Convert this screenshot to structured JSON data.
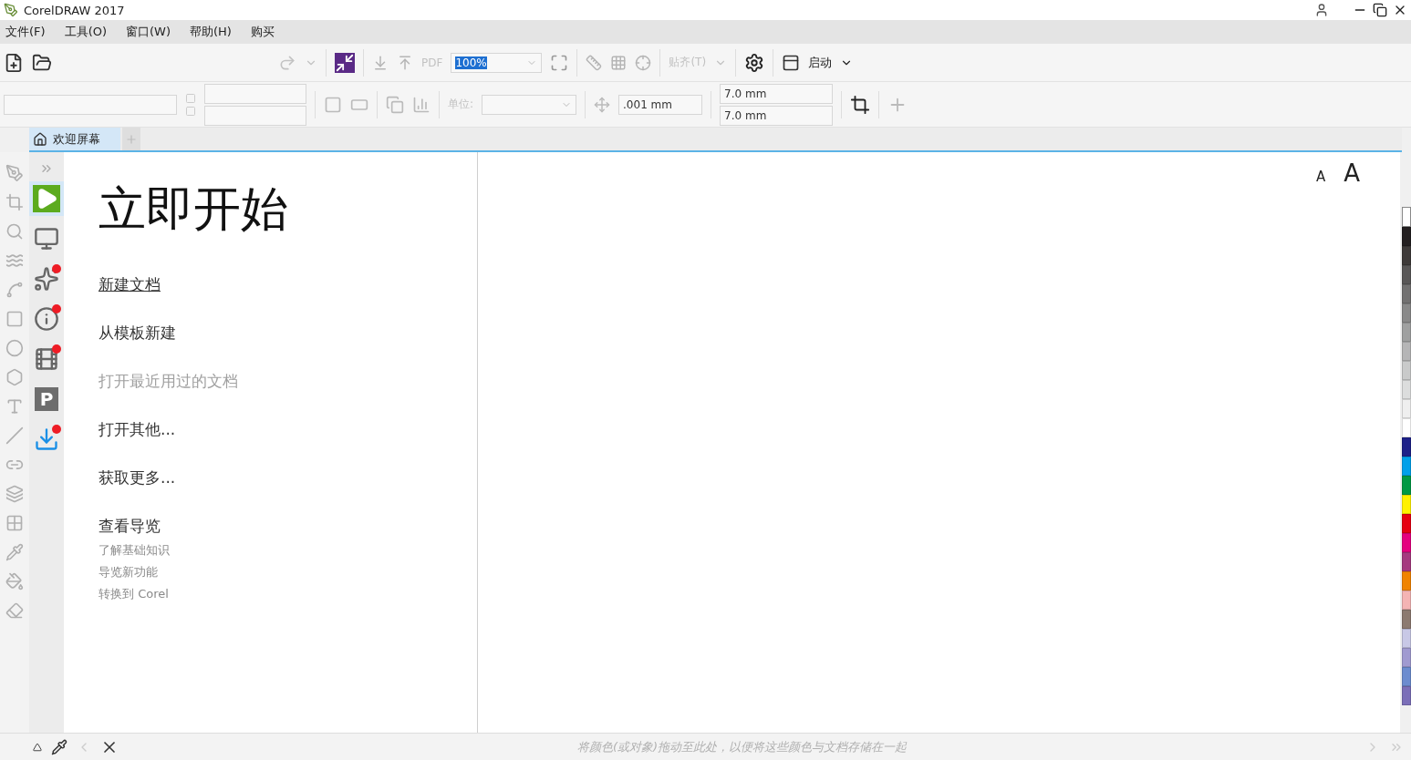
{
  "window": {
    "title": "CorelDRAW 2017"
  },
  "menu": [
    {
      "label": "文件(F)"
    },
    {
      "label": "工具(O)"
    },
    {
      "label": "窗口(W)"
    },
    {
      "label": "帮助(H)"
    },
    {
      "label": "购买"
    }
  ],
  "toolbar": {
    "pdf_label": "PDF",
    "zoom": "100%",
    "snap": "贴齐(T)",
    "launch": "启动"
  },
  "property_bar": {
    "unit_label": "单位:",
    "nudge": ".001 mm",
    "dup_x": "7.0 mm",
    "dup_y": "7.0 mm"
  },
  "tabs": [
    {
      "label": "欢迎屏幕",
      "selected": true
    }
  ],
  "docker_items": [
    {
      "kind": "play",
      "selected": true,
      "badge": false
    },
    {
      "kind": "display",
      "selected": false,
      "badge": false
    },
    {
      "kind": "spark",
      "selected": false,
      "badge": true
    },
    {
      "kind": "info",
      "selected": false,
      "badge": true
    },
    {
      "kind": "film",
      "selected": false,
      "badge": true
    },
    {
      "kind": "letter",
      "glyph": "P",
      "selected": false,
      "badge": false
    },
    {
      "kind": "download",
      "selected": false,
      "badge": true
    }
  ],
  "welcome": {
    "title": "立即开始",
    "font_small": "A",
    "font_large": "A",
    "links": [
      {
        "label": "新建文档",
        "disabled": false,
        "hovered": true
      },
      {
        "label": "从模板新建",
        "disabled": false,
        "hovered": false
      },
      {
        "label": "打开最近用过的文档",
        "disabled": true,
        "hovered": false
      },
      {
        "label": "打开其他...",
        "disabled": false,
        "hovered": false
      },
      {
        "label": "获取更多...",
        "disabled": false,
        "hovered": false
      }
    ],
    "tour": {
      "title": "查看导览",
      "items": [
        "了解基础知识",
        "导览新功能",
        "转换到 Corel"
      ]
    }
  },
  "palette": [
    {
      "color": "#231f20"
    },
    {
      "color": "#3e3a39"
    },
    {
      "color": "#595757"
    },
    {
      "color": "#727171"
    },
    {
      "color": "#898989"
    },
    {
      "color": "#9fa0a0"
    },
    {
      "color": "#b5b5b6"
    },
    {
      "color": "#c9caca"
    },
    {
      "color": "#dcdddd"
    },
    {
      "color": "#efefef"
    },
    {
      "color": "#ffffff"
    },
    {
      "color": "#1d2088"
    },
    {
      "color": "#00a0e9"
    },
    {
      "color": "#009944"
    },
    {
      "color": "#fff100"
    },
    {
      "color": "#e60012"
    },
    {
      "color": "#e4007f"
    },
    {
      "color": "#a5397f"
    },
    {
      "color": "#f08300"
    },
    {
      "color": "#f4b4b4"
    },
    {
      "color": "#8c7a70"
    },
    {
      "color": "#c8c8e6"
    },
    {
      "color": "#a09ad0"
    },
    {
      "color": "#6c8ccf"
    },
    {
      "color": "#7b6fb8"
    }
  ],
  "status_bar": {
    "hint": "将颜色(或对象)拖动至此处，以便将这些颜色与文档存储在一起"
  }
}
